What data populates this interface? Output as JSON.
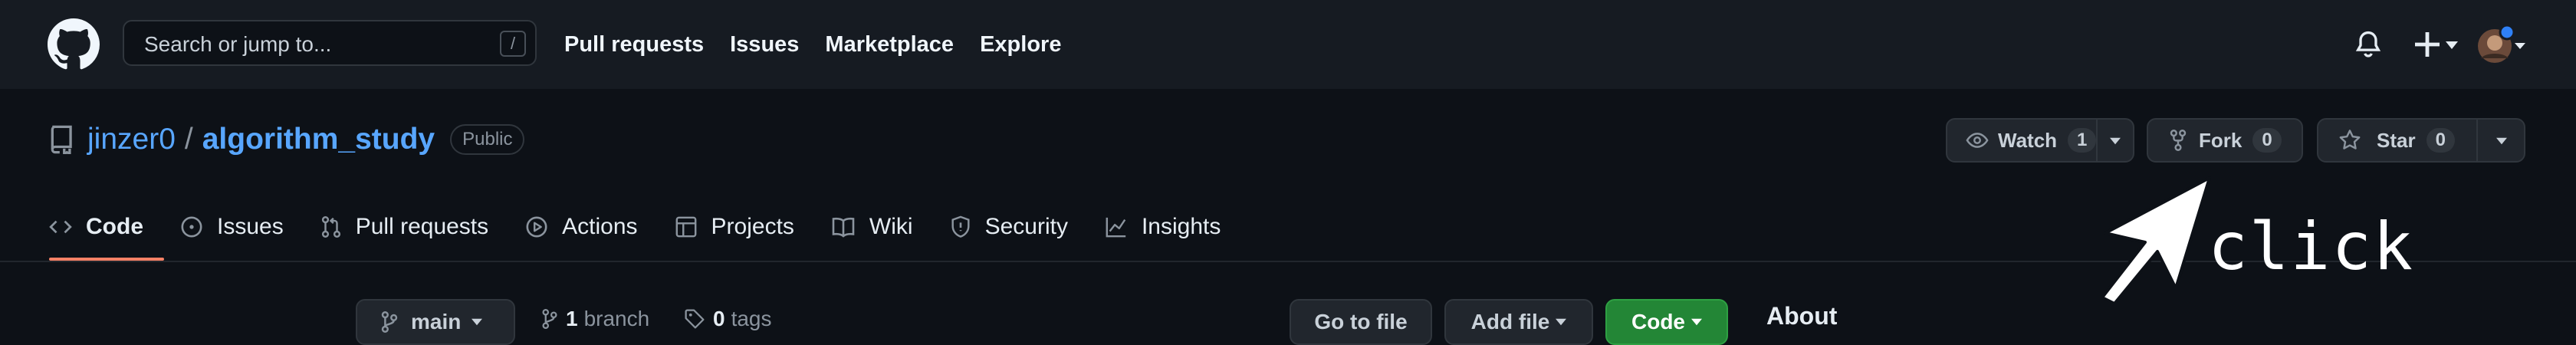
{
  "header": {
    "search_placeholder": "Search or jump to...",
    "search_shortcut": "/",
    "nav": [
      "Pull requests",
      "Issues",
      "Marketplace",
      "Explore"
    ]
  },
  "repo": {
    "owner": "jinzer0",
    "separator": "/",
    "name": "algorithm_study",
    "visibility": "Public",
    "watch_label": "Watch",
    "watch_count": "1",
    "fork_label": "Fork",
    "fork_count": "0",
    "star_label": "Star",
    "star_count": "0"
  },
  "tabs": [
    {
      "label": "Code",
      "icon": "code-icon",
      "active": true
    },
    {
      "label": "Issues",
      "icon": "issue-icon"
    },
    {
      "label": "Pull requests",
      "icon": "pull-request-icon"
    },
    {
      "label": "Actions",
      "icon": "actions-icon"
    },
    {
      "label": "Projects",
      "icon": "projects-icon"
    },
    {
      "label": "Wiki",
      "icon": "wiki-icon"
    },
    {
      "label": "Security",
      "icon": "shield-icon"
    },
    {
      "label": "Insights",
      "icon": "graph-icon"
    }
  ],
  "code": {
    "branch": "main",
    "branch_count": "1",
    "branch_label": "branch",
    "tag_count": "0",
    "tag_label": "tags",
    "go_to_file": "Go to file",
    "add_file": "Add file",
    "code_button": "Code",
    "about_heading": "About"
  },
  "annotation": {
    "text": "click"
  },
  "colors": {
    "background": "#0d1117",
    "header": "#161b22",
    "link": "#58a6ff",
    "active_tab_underline": "#f78166",
    "code_button": "#238636"
  }
}
